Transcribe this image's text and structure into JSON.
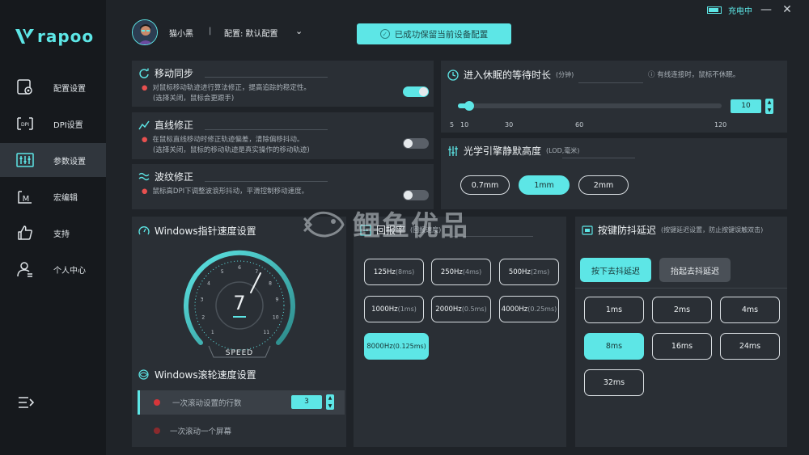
{
  "brand": {
    "name": "rapoo",
    "color": "#5de6e6"
  },
  "sidebar": {
    "items": [
      {
        "label": "配置设置",
        "icon": "config-icon"
      },
      {
        "label": "DPI设置",
        "icon": "dpi-icon"
      },
      {
        "label": "参数设置",
        "icon": "sliders-icon"
      },
      {
        "label": "宏编辑",
        "icon": "macro-icon"
      },
      {
        "label": "支持",
        "icon": "thumbs-up-icon"
      },
      {
        "label": "个人中心",
        "icon": "user-icon"
      }
    ],
    "active_index": 2
  },
  "topbar": {
    "charging": "充电中",
    "user_name": "猫小黑",
    "separator": "|",
    "config_label": "配置: 默认配置",
    "toast": "已成功保留当前设备配置"
  },
  "motion_sync": {
    "title": "移动同步",
    "desc1": "对鼠标移动轨迹进行算法修正，提高追踪的稳定性。",
    "desc2": "(选择关闭，鼠标会更跟手)",
    "enabled": true
  },
  "angle_snap": {
    "title": "直线修正",
    "desc1": "在鼠标直线移动时修正轨迹偏差，清除偏移抖动。",
    "desc2": "(选择关闭，鼠标的移动轨迹是真实操作的移动轨迹)",
    "enabled": false
  },
  "ripple": {
    "title": "波纹修正",
    "desc1": "鼠标高DPI下调整波浪形抖动，平滑控制移动速度。",
    "enabled": false
  },
  "sleep": {
    "title": "进入休眠的等待时长",
    "unit": "(分钟)",
    "note": "有线连接时，鼠标不休眠。",
    "value": "10",
    "min": 5,
    "max": 120,
    "ticks": [
      "5",
      "10",
      "30",
      "60",
      "120"
    ]
  },
  "lod": {
    "title": "光学引擎静默高度",
    "unit": "(LOD,毫米)",
    "options": [
      "0.7mm",
      "1mm",
      "2mm"
    ],
    "selected": 1
  },
  "pointer_speed": {
    "title": "Windows指针速度设置",
    "value": "7",
    "label": "SPEED",
    "dial_ticks": [
      "1",
      "2",
      "3",
      "4",
      "5",
      "6",
      "7",
      "8",
      "9",
      "10",
      "11"
    ]
  },
  "scroll": {
    "title": "Windows滚轮速度设置",
    "row1": "一次滚动设置的行数",
    "row1_value": "3",
    "row2": "一次滚动一个屏幕"
  },
  "polling": {
    "title": "回报率",
    "title_sub": "(回报速度)",
    "options": [
      {
        "hz": "125Hz",
        "ms": "(8ms)"
      },
      {
        "hz": "250Hz",
        "ms": "(4ms)"
      },
      {
        "hz": "500Hz",
        "ms": "(2ms)"
      },
      {
        "hz": "1000Hz",
        "ms": "(1ms)"
      },
      {
        "hz": "2000Hz",
        "ms": "(0.5ms)"
      },
      {
        "hz": "4000Hz",
        "ms": "(0.25ms)"
      },
      {
        "hz": "8000Hz",
        "ms": "(0.125ms)"
      }
    ],
    "selected": 6
  },
  "debounce": {
    "title": "按键防抖延迟",
    "title_sub": "(按键延迟设置，防止按键误触双击)",
    "mode_press": "按下去抖延迟",
    "mode_release": "抬起去抖延迟",
    "options": [
      "1ms",
      "2ms",
      "4ms",
      "8ms",
      "16ms",
      "24ms",
      "32ms"
    ],
    "selected": 3
  },
  "watermark": "鲤鱼优品"
}
